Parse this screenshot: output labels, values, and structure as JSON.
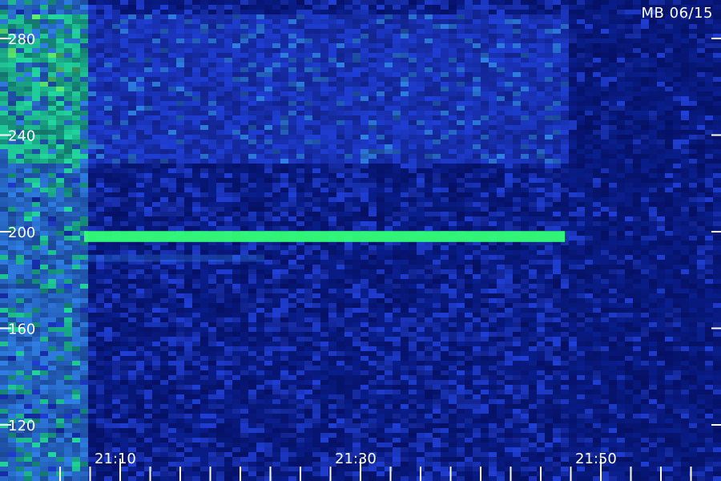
{
  "chart_data": {
    "type": "heatmap",
    "title": "MB 06/15",
    "xlabel": "",
    "ylabel": "",
    "y_axis": {
      "range": [
        108,
        290
      ],
      "ticks": [
        120,
        160,
        200,
        240,
        280
      ],
      "tick_labels": [
        "120",
        "160",
        "200",
        "240",
        "280"
      ]
    },
    "x_axis": {
      "range": [
        "21:01",
        "21:59"
      ],
      "major_ticks": [
        "21:10",
        "21:30",
        "21:50"
      ],
      "tick_labels": [
        "21:10",
        "21:30",
        "21:50"
      ],
      "minor_tick_interval_minutes": 2.5
    },
    "colormap": [
      "#000033",
      "#0a1f8f",
      "#1f3fd6",
      "#2f7fe6",
      "#22d9a0",
      "#66ff77"
    ],
    "features": [
      {
        "kind": "horizontal-line",
        "y": 198,
        "x_start": "21:07",
        "x_end": "21:47",
        "intensity": 0.95,
        "color": "#33ff77"
      },
      {
        "kind": "horizontal-line",
        "y": 189,
        "x_start": "21:07",
        "x_end": "21:22",
        "intensity": 0.35,
        "color": "#2f7fe6"
      },
      {
        "kind": "noise-region",
        "x_start": "21:01",
        "x_end": "21:07",
        "intensity": 0.65,
        "note": ""
      },
      {
        "kind": "noise-region",
        "x_start": "21:07",
        "x_end": "21:47",
        "y_range": [
          230,
          290
        ],
        "intensity": 0.5
      }
    ]
  }
}
